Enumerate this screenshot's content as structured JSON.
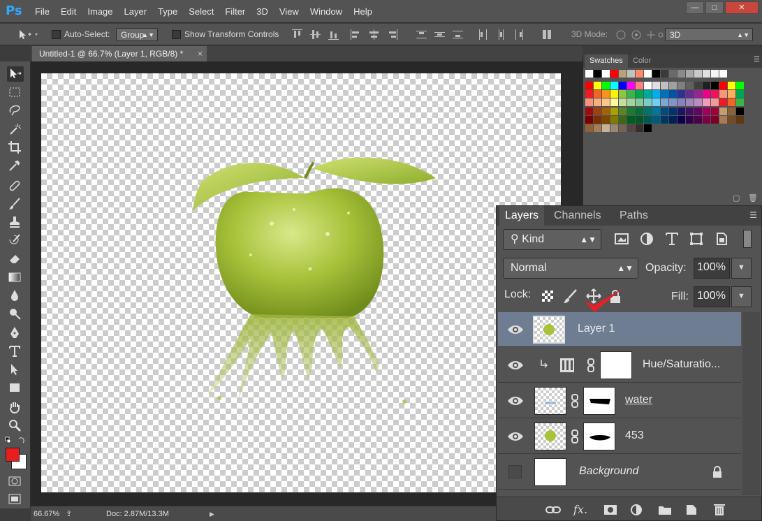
{
  "app": {
    "logo": "Ps",
    "menu": [
      "File",
      "Edit",
      "Image",
      "Layer",
      "Type",
      "Select",
      "Filter",
      "3D",
      "View",
      "Window",
      "Help"
    ],
    "window_controls": [
      "minimize",
      "restore",
      "close"
    ]
  },
  "options_bar": {
    "auto_select_label": "Auto-Select:",
    "auto_select_value": "Group",
    "show_transform_label": "Show Transform Controls",
    "mode_3d_label": "3D Mode:",
    "workspace_value": "3D"
  },
  "document": {
    "tab_title": "Untitled-1 @ 66.7% (Layer 1, RGB/8) *"
  },
  "status": {
    "zoom": "66.67%",
    "doc_info": "Doc: 2.87M/13.3M"
  },
  "swatches_panel": {
    "tabs": [
      "Swatches",
      "Color"
    ],
    "colors": {
      "foreground": "#e81e1e",
      "background": "#ffffff"
    }
  },
  "layers_panel": {
    "tabs": [
      "Layers",
      "Channels",
      "Paths"
    ],
    "filter_kind": "Kind",
    "blend_mode": "Normal",
    "opacity_label": "Opacity:",
    "opacity_value": "100%",
    "lock_label": "Lock:",
    "fill_label": "Fill:",
    "fill_value": "100%",
    "layers": [
      {
        "name": "Layer 1",
        "visible": true,
        "selected": true
      },
      {
        "name": "Hue/Saturatio...",
        "visible": true,
        "selected": false
      },
      {
        "name": "water",
        "visible": true,
        "selected": false
      },
      {
        "name": "453",
        "visible": true,
        "selected": false
      },
      {
        "name": "Background",
        "visible": false,
        "selected": false,
        "locked": true
      }
    ]
  },
  "icons": [
    "move-icon",
    "marquee-icon",
    "lasso-icon",
    "magic-wand-icon",
    "crop-icon",
    "eyedropper-icon",
    "healing-icon",
    "brush-icon",
    "stamp-icon",
    "history-brush-icon",
    "eraser-icon",
    "gradient-icon",
    "blur-icon",
    "dodge-icon",
    "pen-icon",
    "type-icon",
    "path-select-icon",
    "rectangle-icon",
    "hand-icon",
    "zoom-icon"
  ]
}
